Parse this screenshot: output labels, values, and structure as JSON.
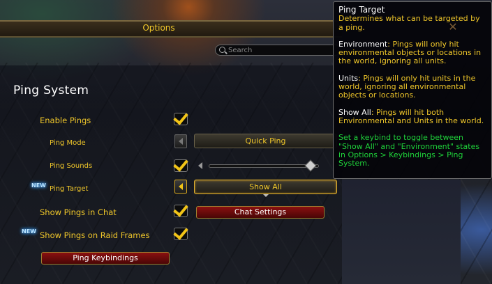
{
  "window": {
    "title": "Options"
  },
  "search": {
    "placeholder": "Search"
  },
  "section": {
    "title": "Ping System"
  },
  "settings": {
    "enable_pings": {
      "label": "Enable Pings",
      "checked": true
    },
    "ping_mode": {
      "label": "Ping Mode",
      "value": "Quick Ping"
    },
    "ping_sounds": {
      "label": "Ping Sounds",
      "checked": true,
      "volume_fraction": 0.97
    },
    "ping_target": {
      "label": "Ping Target",
      "badge": "NEW",
      "value": "Show All"
    },
    "show_pings_in_chat": {
      "label": "Show Pings in Chat",
      "checked": true,
      "button": "Chat Settings"
    },
    "show_pings_raid": {
      "label": "Show Pings on Raid Frames",
      "badge": "NEW",
      "checked": true
    },
    "keybindings_button": "Ping Keybindings"
  },
  "tooltip": {
    "title": "Ping Target",
    "description": "Determines what can be targeted by a ping.",
    "environment": {
      "key": "Environment",
      "text": ": Pings will only hit environmental objects or locations in the world, ignoring all units."
    },
    "units": {
      "key": "Units",
      "text": ": Pings will only hit units in the world, ignoring all environmental objects or locations."
    },
    "show_all": {
      "key": "Show All",
      "text": ": Pings will hit both Environmental and Units in the world."
    },
    "note": "Set a keybind to toggle between \"Show All\" and \"Environment\" states in Options > Keybindings > Ping System."
  },
  "colors": {
    "label_gold": "#f0c72a",
    "tooltip_green": "#1fd33a",
    "button_red": "#8a1010",
    "new_badge": "#bfe6ff"
  }
}
